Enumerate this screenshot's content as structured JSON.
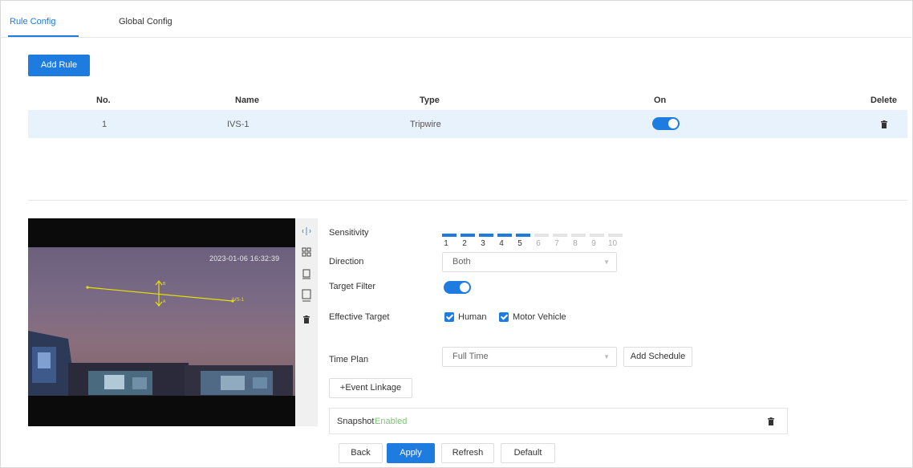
{
  "tabs": {
    "rule_config": "Rule Config",
    "global_config": "Global Config"
  },
  "add_rule": "Add Rule",
  "table": {
    "headers": {
      "no": "No.",
      "name": "Name",
      "type": "Type",
      "on": "On",
      "delete": "Delete"
    },
    "rows": [
      {
        "no": "1",
        "name": "IVS-1",
        "type": "Tripwire",
        "on": true
      }
    ]
  },
  "video": {
    "timestamp": "2023-01-06 16:32:39",
    "rule_label": "IVS-1",
    "arrow_a": "A",
    "arrow_b": "B"
  },
  "form": {
    "sensitivity_label": "Sensitivity",
    "sensitivity_value": 5,
    "sensitivity_scale": [
      "1",
      "2",
      "3",
      "4",
      "5",
      "6",
      "7",
      "8",
      "9",
      "10"
    ],
    "direction_label": "Direction",
    "direction_value": "Both",
    "target_filter_label": "Target Filter",
    "target_filter_on": true,
    "effective_target_label": "Effective Target",
    "target_human": "Human",
    "target_vehicle": "Motor Vehicle",
    "time_plan_label": "Time Plan",
    "time_plan_value": "Full Time",
    "add_schedule": "Add Schedule",
    "event_linkage": "+Event Linkage",
    "snapshot_label": "Snapshot",
    "snapshot_status": "Enabled"
  },
  "actions": {
    "back": "Back",
    "apply": "Apply",
    "refresh": "Refresh",
    "default": "Default"
  },
  "colors": {
    "accent": "#1e7be0",
    "enabled": "#7cc576",
    "row_highlight": "#e8f2fd",
    "tripwire": "#e4e300"
  }
}
